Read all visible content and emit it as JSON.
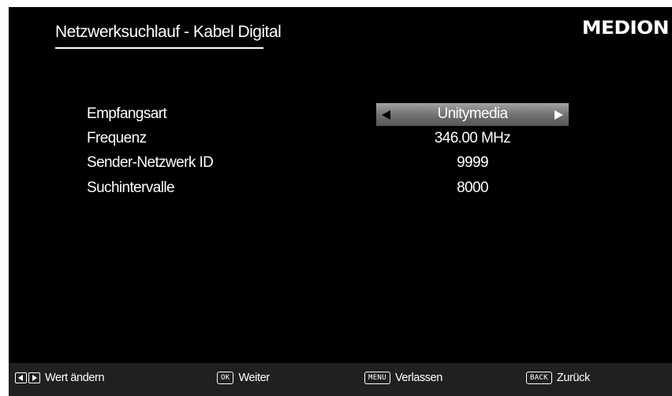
{
  "header": {
    "title": "Netzwerksuchlauf - Kabel Digital",
    "logo_text": "MEDION"
  },
  "settings": [
    {
      "label": "Empfangsart",
      "value": "Unitymedia",
      "selectable": true
    },
    {
      "label": "Frequenz",
      "value": "346.00 MHz",
      "selectable": false
    },
    {
      "label": "Sender-Netzwerk ID",
      "value": "9999",
      "selectable": false
    },
    {
      "label": "Suchintervalle",
      "value": "8000",
      "selectable": false
    }
  ],
  "footer": {
    "hints": [
      {
        "key": "left-right-arrows",
        "label": "Wert ändern"
      },
      {
        "key": "OK",
        "label": "Weiter"
      },
      {
        "key": "MENU",
        "label": "Verlassen"
      },
      {
        "key": "BACK",
        "label": "Zurück"
      }
    ]
  },
  "colors": {
    "background": "#000000",
    "text": "#ffffff",
    "selector_top": "#a2a2a2",
    "selector_bottom": "#565656",
    "footer": "#202020"
  }
}
